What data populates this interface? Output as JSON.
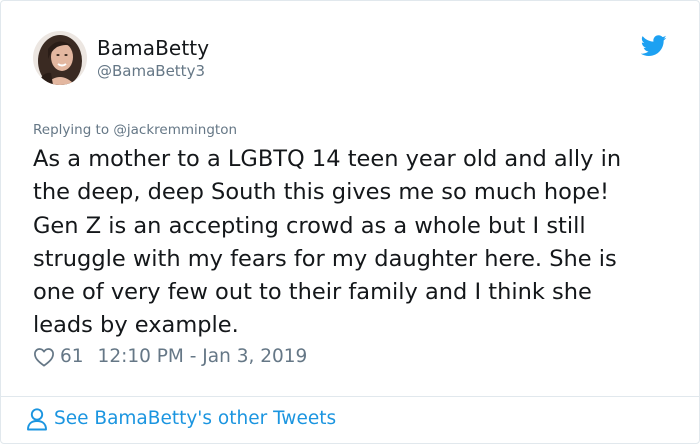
{
  "author": {
    "display_name": "BamaBetty",
    "handle": "@BamaBetty3"
  },
  "reply": {
    "text": "Replying to @jackremmington"
  },
  "tweet": {
    "text": "As a mother to a LGBTQ 14 teen year old and ally in\nthe deep, deep South this gives me so much hope!\nGen Z is an accepting crowd as a whole but I still\nstruggle with my fears for my daughter here. She is\none of very few out to their family and I think she\nleads by example."
  },
  "meta": {
    "like_count": "61",
    "timestamp": "12:10 PM - Jan 3, 2019"
  },
  "footer": {
    "link_text": "See BamaBetty's other Tweets"
  },
  "icons": {
    "brand": "twitter-bird-icon",
    "like": "heart-icon",
    "profile": "person-icon"
  },
  "colors": {
    "accent": "#1da1f2",
    "link": "#1b95e0",
    "secondary_text": "#657786",
    "primary_text": "#14171a",
    "border": "#e1e8ed"
  }
}
